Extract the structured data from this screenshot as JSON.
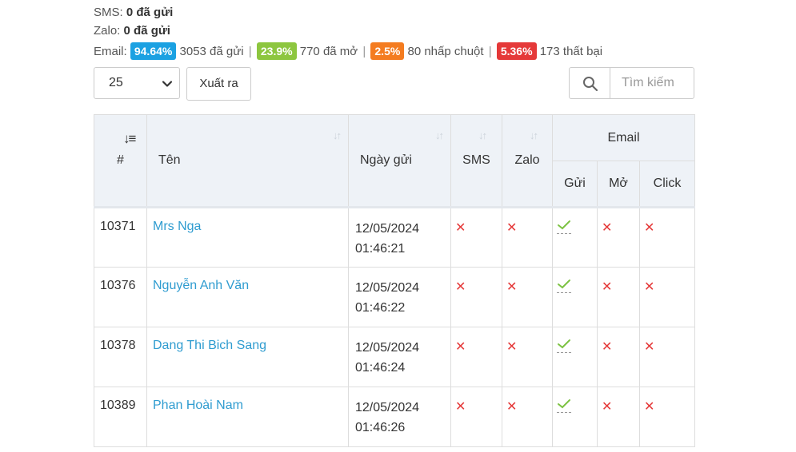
{
  "stats": {
    "sms_label": "SMS:",
    "sms_value": "0 đã gửi",
    "zalo_label": "Zalo:",
    "zalo_value": "0 đã gửi",
    "email_label": "Email:",
    "sent_pct": "94.64%",
    "sent_text": "3053 đã gửi",
    "open_pct": "23.9%",
    "open_text": "770 đã mở",
    "click_pct": "2.5%",
    "click_text": "80 nhấp chuột",
    "fail_pct": "5.36%",
    "fail_text": "173 thất bại",
    "separator": "|",
    "colors": {
      "sent": "#1ba1e2",
      "open": "#8dc63f",
      "click": "#f47c20",
      "fail": "#e53939"
    }
  },
  "toolbar": {
    "page_size": "25",
    "export_label": "Xuất ra",
    "search_placeholder": "Tìm kiếm"
  },
  "table": {
    "headers": {
      "id": "#",
      "name": "Tên",
      "date": "Ngày gửi",
      "sms": "SMS",
      "zalo": "Zalo",
      "email": "Email",
      "sent": "Gửi",
      "open": "Mở",
      "click": "Click"
    },
    "rows": [
      {
        "id": "10371",
        "name": "Mrs Nga",
        "date": "12/05/2024",
        "time": "01:46:21"
      },
      {
        "id": "10376",
        "name": "Nguyễn Anh Văn",
        "date": "12/05/2024",
        "time": "01:46:22"
      },
      {
        "id": "10378",
        "name": "Dang Thi Bich Sang",
        "date": "12/05/2024",
        "time": "01:46:24"
      },
      {
        "id": "10389",
        "name": "Phan Hoài Nam",
        "date": "12/05/2024",
        "time": "01:46:26"
      }
    ],
    "status_icons": {
      "sms": "cross-icon",
      "zalo": "cross-icon",
      "sent": "check-icon",
      "open": "cross-icon",
      "click": "cross-icon"
    }
  }
}
